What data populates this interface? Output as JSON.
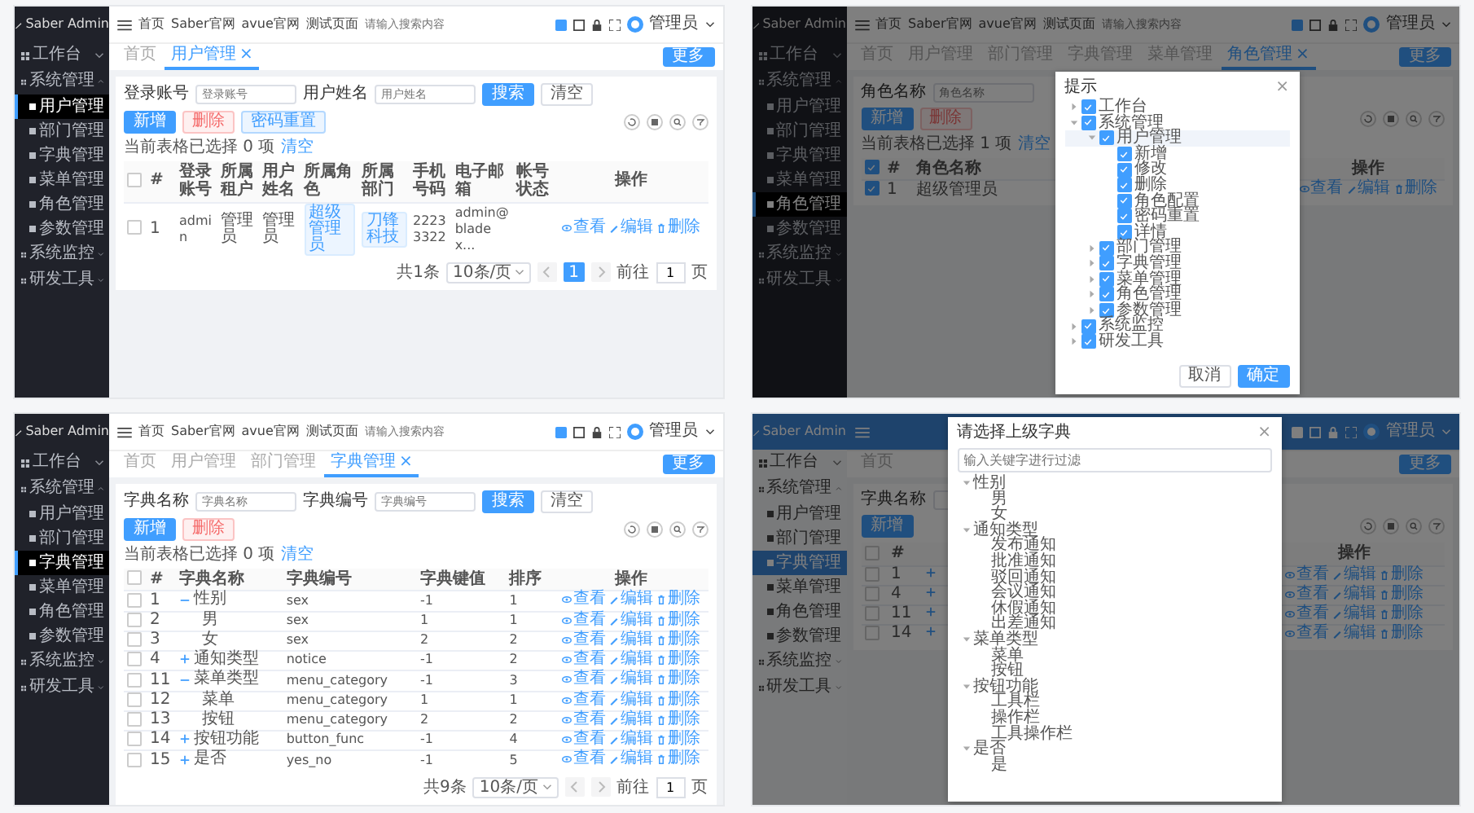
{
  "panels": [
    {
      "kind": "dark",
      "logo": "Saber Admin",
      "sidebar": [
        {
          "label": "工作台",
          "selected": false,
          "expanded": false
        },
        {
          "label": "系统管理",
          "selected": false,
          "expanded": true,
          "children": [
            {
              "label": "用户管理",
              "selected": true
            },
            {
              "label": "部门管理",
              "selected": false
            },
            {
              "label": "字典管理",
              "selected": false
            },
            {
              "label": "菜单管理",
              "selected": false
            },
            {
              "label": "角色管理",
              "selected": false
            },
            {
              "label": "参数管理",
              "selected": false
            }
          ]
        },
        {
          "label": "系统监控",
          "selected": false,
          "expanded": false
        },
        {
          "label": "研发工具",
          "selected": false,
          "expanded": false
        }
      ],
      "nav": {
        "links": [
          "首页",
          "Saber官网",
          "avue官网",
          "测试页面"
        ],
        "search_placeholder": "请输入搜索内容",
        "user": "管理员"
      },
      "tabs": [
        {
          "label": "首页",
          "selected": false
        },
        {
          "label": "用户管理",
          "selected": true,
          "close": "×"
        }
      ],
      "more": "更多",
      "search": {
        "fields": [
          {
            "label": "登录账号",
            "placeholder": "登录账号"
          },
          {
            "label": "用户姓名",
            "placeholder": "用户姓名"
          }
        ],
        "search_button": "搜索",
        "reset_button": "清空"
      },
      "actions": [
        {
          "label": "新增",
          "kind": "primary"
        },
        {
          "label": "删除",
          "kind": "danger"
        },
        {
          "label": "密码重置",
          "kind": "info"
        }
      ],
      "selection": {
        "text": "当前表格已选择 0 项",
        "clear": "清空"
      },
      "table": {
        "header_checked": false,
        "index_label": "#",
        "columns": [
          "登录账号",
          "所属租户",
          "用户姓名",
          "所属角色",
          "所属部门",
          "手机号码",
          "电子邮箱",
          "帐号状态"
        ],
        "ops_label": "操作",
        "rows": [
          {
            "checked": false,
            "index": "1",
            "cells": [
              "admin",
              "管理员",
              "管理员",
              {
                "text": "超级管理员",
                "kind": "tag"
              },
              {
                "text": "刀锋科技",
                "kind": "tag"
              },
              "22233322",
              "admin@bladex..."
            ],
            "ops": [
              {
                "label": "查看",
                "kind": "view"
              },
              {
                "label": "编辑",
                "kind": "edit"
              },
              {
                "label": "删除",
                "kind": "delete"
              }
            ]
          }
        ]
      },
      "pagination": {
        "total": "共1条",
        "size": "10条/页",
        "pages": [
          {
            "label": "1",
            "selected": true
          }
        ],
        "goto": "前往",
        "goto_value": "1",
        "unit": "页"
      }
    },
    {
      "kind": "dark",
      "logo": "Saber Admin",
      "sidebar": [
        {
          "label": "工作台",
          "selected": false,
          "expanded": false
        },
        {
          "label": "系统管理",
          "selected": false,
          "expanded": true,
          "children": [
            {
              "label": "用户管理",
              "selected": false
            },
            {
              "label": "部门管理",
              "selected": false
            },
            {
              "label": "字典管理",
              "selected": false
            },
            {
              "label": "菜单管理",
              "selected": false
            },
            {
              "label": "角色管理",
              "selected": true
            },
            {
              "label": "参数管理",
              "selected": false
            }
          ]
        },
        {
          "label": "系统监控",
          "selected": false,
          "expanded": false
        },
        {
          "label": "研发工具",
          "selected": false,
          "expanded": false
        }
      ],
      "nav": {
        "links": [
          "首页",
          "Saber官网",
          "avue官网",
          "测试页面"
        ],
        "search_placeholder": "请输入搜索内容",
        "user": "管理员"
      },
      "tabs": [
        {
          "label": "首页",
          "selected": false
        },
        {
          "label": "用户管理",
          "selected": false
        },
        {
          "label": "部门管理",
          "selected": false
        },
        {
          "label": "字典管理",
          "selected": false
        },
        {
          "label": "菜单管理",
          "selected": false
        },
        {
          "label": "角色管理",
          "selected": true,
          "close": "×"
        }
      ],
      "more": "更多",
      "search": {
        "fields": [
          {
            "label": "角色名称",
            "placeholder": "角色名称"
          }
        ]
      },
      "actions": [
        {
          "label": "新增",
          "kind": "primary"
        },
        {
          "label": "删除",
          "kind": "danger"
        }
      ],
      "selection": {
        "text": "当前表格已选择 1 项",
        "clear": "清空"
      },
      "table": {
        "header_checked": true,
        "index_label": "#",
        "columns": [
          "角色名称"
        ],
        "ops_label": "操作",
        "rows": [
          {
            "checked": true,
            "index": "1",
            "cells": [
              "超级管理员"
            ],
            "ops": [
              {
                "label": "查看",
                "kind": "view"
              },
              {
                "label": "编辑",
                "kind": "edit"
              },
              {
                "label": "删除",
                "kind": "delete"
              }
            ]
          }
        ]
      },
      "modal": {
        "kind": "permission",
        "title": "提示",
        "close": "×",
        "tree": [
          {
            "label": "工作台",
            "checked": true,
            "expanded": false,
            "selected": false
          },
          {
            "label": "系统管理",
            "checked": true,
            "expanded": true,
            "selected": false,
            "children": [
              {
                "label": "用户管理",
                "checked": true,
                "expanded": true,
                "selected": true,
                "children": [
                  {
                    "label": "新增",
                    "checked": true,
                    "selected": false
                  },
                  {
                    "label": "修改",
                    "checked": true,
                    "selected": false
                  },
                  {
                    "label": "删除",
                    "checked": true,
                    "selected": false
                  },
                  {
                    "label": "角色配置",
                    "checked": true,
                    "selected": false
                  },
                  {
                    "label": "密码重置",
                    "checked": true,
                    "selected": false
                  },
                  {
                    "label": "详情",
                    "checked": true,
                    "selected": false
                  }
                ]
              },
              {
                "label": "部门管理",
                "checked": true,
                "expanded": false,
                "selected": false
              },
              {
                "label": "字典管理",
                "checked": true,
                "expanded": false,
                "selected": false
              },
              {
                "label": "菜单管理",
                "checked": true,
                "expanded": false,
                "selected": false
              },
              {
                "label": "角色管理",
                "checked": true,
                "expanded": false,
                "selected": false
              },
              {
                "label": "参数管理",
                "checked": true,
                "expanded": false,
                "selected": false
              }
            ]
          },
          {
            "label": "系统监控",
            "checked": true,
            "expanded": false,
            "selected": false
          },
          {
            "label": "研发工具",
            "checked": true,
            "expanded": false,
            "selected": false
          }
        ],
        "buttons": [
          {
            "label": "取消",
            "kind": "plain"
          },
          {
            "label": "确定",
            "kind": "primary"
          }
        ]
      }
    },
    {
      "kind": "dark",
      "logo": "Saber Admin",
      "sidebar": [
        {
          "label": "工作台",
          "selected": false,
          "expanded": false
        },
        {
          "label": "系统管理",
          "selected": false,
          "expanded": true,
          "children": [
            {
              "label": "用户管理",
              "selected": false
            },
            {
              "label": "部门管理",
              "selected": false
            },
            {
              "label": "字典管理",
              "selected": true
            },
            {
              "label": "菜单管理",
              "selected": false
            },
            {
              "label": "角色管理",
              "selected": false
            },
            {
              "label": "参数管理",
              "selected": false
            }
          ]
        },
        {
          "label": "系统监控",
          "selected": false,
          "expanded": false
        },
        {
          "label": "研发工具",
          "selected": false,
          "expanded": false
        }
      ],
      "nav": {
        "links": [
          "首页",
          "Saber官网",
          "avue官网",
          "测试页面"
        ],
        "search_placeholder": "请输入搜索内容",
        "user": "管理员"
      },
      "tabs": [
        {
          "label": "首页",
          "selected": false
        },
        {
          "label": "用户管理",
          "selected": false
        },
        {
          "label": "部门管理",
          "selected": false
        },
        {
          "label": "字典管理",
          "selected": true,
          "close": "×"
        }
      ],
      "more": "更多",
      "search": {
        "fields": [
          {
            "label": "字典名称",
            "placeholder": "字典名称"
          },
          {
            "label": "字典编号",
            "placeholder": "字典编号"
          }
        ],
        "search_button": "搜索",
        "reset_button": "清空"
      },
      "actions": [
        {
          "label": "新增",
          "kind": "primary"
        },
        {
          "label": "删除",
          "kind": "danger"
        }
      ],
      "selection": {
        "text": "当前表格已选择 0 项",
        "clear": "清空"
      },
      "table": {
        "header_checked": false,
        "index_label": "#",
        "columns": [
          "字典名称",
          "字典编号",
          "字典键值",
          "排序"
        ],
        "ops_label": "操作",
        "rows": [
          {
            "checked": false,
            "index": "1",
            "expanded": true,
            "cells": [
              "性别",
              "sex",
              "-1",
              "1"
            ],
            "ops": [
              {
                "label": "查看",
                "kind": "view"
              },
              {
                "label": "编辑",
                "kind": "edit"
              },
              {
                "label": "删除",
                "kind": "delete"
              }
            ],
            "children": [
              {
                "checked": false,
                "index": "2",
                "cells": [
                  "男",
                  "sex",
                  "1",
                  "1"
                ],
                "ops": [
                  {
                    "label": "查看",
                    "kind": "view"
                  },
                  {
                    "label": "编辑",
                    "kind": "edit"
                  },
                  {
                    "label": "删除",
                    "kind": "delete"
                  }
                ]
              },
              {
                "checked": false,
                "index": "3",
                "cells": [
                  "女",
                  "sex",
                  "2",
                  "2"
                ],
                "ops": [
                  {
                    "label": "查看",
                    "kind": "view"
                  },
                  {
                    "label": "编辑",
                    "kind": "edit"
                  },
                  {
                    "label": "删除",
                    "kind": "delete"
                  }
                ]
              }
            ]
          },
          {
            "checked": false,
            "index": "4",
            "expanded": false,
            "cells": [
              "通知类型",
              "notice",
              "-1",
              "2"
            ],
            "ops": [
              {
                "label": "查看",
                "kind": "view"
              },
              {
                "label": "编辑",
                "kind": "edit"
              },
              {
                "label": "删除",
                "kind": "delete"
              }
            ]
          },
          {
            "checked": false,
            "index": "11",
            "expanded": true,
            "cells": [
              "菜单类型",
              "menu_category",
              "-1",
              "3"
            ],
            "ops": [
              {
                "label": "查看",
                "kind": "view"
              },
              {
                "label": "编辑",
                "kind": "edit"
              },
              {
                "label": "删除",
                "kind": "delete"
              }
            ],
            "children": [
              {
                "checked": false,
                "index": "12",
                "cells": [
                  "菜单",
                  "menu_category",
                  "1",
                  "1"
                ],
                "ops": [
                  {
                    "label": "查看",
                    "kind": "view"
                  },
                  {
                    "label": "编辑",
                    "kind": "edit"
                  },
                  {
                    "label": "删除",
                    "kind": "delete"
                  }
                ]
              },
              {
                "checked": false,
                "index": "13",
                "cells": [
                  "按钮",
                  "menu_category",
                  "2",
                  "2"
                ],
                "ops": [
                  {
                    "label": "查看",
                    "kind": "view"
                  },
                  {
                    "label": "编辑",
                    "kind": "edit"
                  },
                  {
                    "label": "删除",
                    "kind": "delete"
                  }
                ]
              }
            ]
          },
          {
            "checked": false,
            "index": "14",
            "expanded": false,
            "cells": [
              "按钮功能",
              "button_func",
              "-1",
              "4"
            ],
            "ops": [
              {
                "label": "查看",
                "kind": "view"
              },
              {
                "label": "编辑",
                "kind": "edit"
              },
              {
                "label": "删除",
                "kind": "delete"
              }
            ]
          },
          {
            "checked": false,
            "index": "15",
            "expanded": false,
            "cells": [
              "是否",
              "yes_no",
              "-1",
              "5"
            ],
            "ops": [
              {
                "label": "查看",
                "kind": "view"
              },
              {
                "label": "编辑",
                "kind": "edit"
              },
              {
                "label": "删除",
                "kind": "delete"
              }
            ]
          }
        ]
      },
      "pagination": {
        "total": "共9条",
        "size": "10条/页",
        "goto": "前往",
        "goto_value": "1",
        "unit": "页"
      }
    },
    {
      "kind": "blue",
      "logo": "Saber Admin",
      "sidebar": [
        {
          "label": "工作台",
          "selected": false,
          "expanded": false
        },
        {
          "label": "系统管理",
          "selected": false,
          "expanded": true,
          "children": [
            {
              "label": "用户管理",
              "selected": false
            },
            {
              "label": "部门管理",
              "selected": false
            },
            {
              "label": "字典管理",
              "selected": true
            },
            {
              "label": "菜单管理",
              "selected": false
            },
            {
              "label": "角色管理",
              "selected": false
            },
            {
              "label": "参数管理",
              "selected": false
            }
          ]
        },
        {
          "label": "系统监控",
          "selected": false,
          "expanded": false
        },
        {
          "label": "研发工具",
          "selected": false,
          "expanded": false
        }
      ],
      "nav": {
        "user": "管理员"
      },
      "tabs": [
        {
          "label": "首页",
          "selected": false
        }
      ],
      "more": "更多",
      "search": {
        "fields": [
          {
            "label": "字典名称"
          }
        ]
      },
      "actions": [
        {
          "label": "新增",
          "kind": "primary"
        }
      ],
      "table": {
        "header_checked": false,
        "index_label": "#",
        "ops_label": "操作",
        "rows": [
          {
            "checked": false,
            "index": "1",
            "expanded": false,
            "ops": [
              {
                "label": "查看",
                "kind": "view"
              },
              {
                "label": "编辑",
                "kind": "edit"
              },
              {
                "label": "删除",
                "kind": "delete"
              }
            ]
          },
          {
            "checked": false,
            "index": "4",
            "expanded": false,
            "ops": [
              {
                "label": "查看",
                "kind": "view"
              },
              {
                "label": "编辑",
                "kind": "edit"
              },
              {
                "label": "删除",
                "kind": "delete"
              }
            ]
          },
          {
            "checked": false,
            "index": "11",
            "expanded": false,
            "ops": [
              {
                "label": "查看",
                "kind": "view"
              },
              {
                "label": "编辑",
                "kind": "edit"
              },
              {
                "label": "删除",
                "kind": "delete"
              }
            ]
          },
          {
            "checked": false,
            "index": "14",
            "expanded": false,
            "ops": [
              {
                "label": "查看",
                "kind": "view"
              },
              {
                "label": "编辑",
                "kind": "edit"
              },
              {
                "label": "删除",
                "kind": "delete"
              }
            ]
          }
        ]
      },
      "modal": {
        "kind": "picker",
        "title": "请选择上级字典",
        "close": "×",
        "filter_placeholder": "输入关键字进行过滤",
        "tree": [
          {
            "label": "性别",
            "expanded": true,
            "children": [
              {
                "label": "男"
              },
              {
                "label": "女"
              }
            ]
          },
          {
            "label": "通知类型",
            "expanded": true,
            "children": [
              {
                "label": "发布通知"
              },
              {
                "label": "批准通知"
              },
              {
                "label": "驳回通知"
              },
              {
                "label": "会议通知"
              },
              {
                "label": "休假通知"
              },
              {
                "label": "出差通知"
              }
            ]
          },
          {
            "label": "菜单类型",
            "expanded": true,
            "children": [
              {
                "label": "菜单"
              },
              {
                "label": "按钮"
              }
            ]
          },
          {
            "label": "按钮功能",
            "expanded": true,
            "children": [
              {
                "label": "工具栏"
              },
              {
                "label": "操作栏"
              },
              {
                "label": "工具操作栏"
              }
            ]
          },
          {
            "label": "是否",
            "expanded": true,
            "children": [
              {
                "label": "是"
              }
            ]
          }
        ]
      }
    }
  ]
}
